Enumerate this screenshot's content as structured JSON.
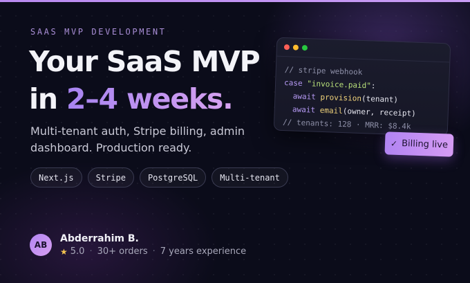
{
  "eyebrow": "SAAS MVP DEVELOPMENT",
  "headline": {
    "line1": "Your SaaS MVP",
    "line2_prefix": "in ",
    "line2_accent": "2–4 weeks."
  },
  "subtext": "Multi-tenant auth, Stripe billing, admin dashboard. Production ready.",
  "tags": [
    "Next.js",
    "Stripe",
    "PostgreSQL",
    "Multi-tenant"
  ],
  "code": {
    "line1": "// stripe webhook",
    "line2_kw": "case",
    "line2_str": "\"invoice.paid\"",
    "line2_end": ":",
    "line3_kw": "await",
    "line3_fn": "provision",
    "line3_args": "(tenant)",
    "line4_kw": "await",
    "line4_fn": "email",
    "line4_args": "(owner, receipt)",
    "line5": "// tenants: 128 · MRR: $8.4k"
  },
  "badge": {
    "check": "✓",
    "label": "Billing live"
  },
  "author": {
    "initials": "AB",
    "name": "Abderrahim B.",
    "star": "★",
    "rating": "5.0",
    "orders": "30+ orders",
    "experience": "7 years experience",
    "separator": "·"
  },
  "colors": {
    "background": "#0b0c1a",
    "accent_start": "#a784f1",
    "accent_end": "#d7a2f0",
    "star": "#f5c451"
  }
}
